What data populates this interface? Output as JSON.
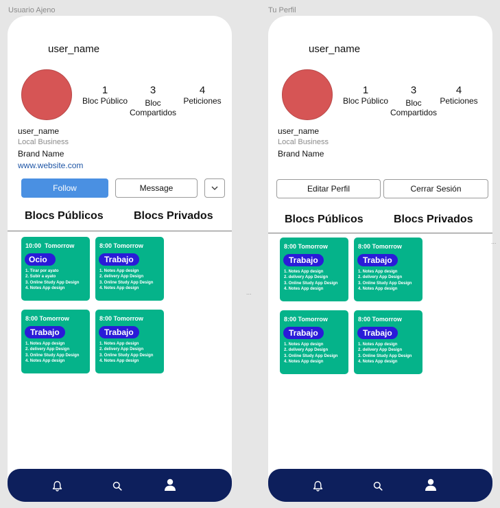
{
  "frames": {
    "left_label": "Usuario Ajeno",
    "right_label": "Tu Perfil"
  },
  "profile": {
    "username_top": "user_name",
    "display_name": "user_name",
    "category": "Local Business",
    "brand": "Brand Name",
    "website": "www.website.com",
    "avatar_color": "#d65555"
  },
  "stats": [
    {
      "value": "1",
      "label": "Bloc Público"
    },
    {
      "value": "3",
      "label_line1": "Bloc",
      "label_line2": "Compartidos"
    },
    {
      "value": "4",
      "label": "Peticiones"
    }
  ],
  "buttons": {
    "follow": "Follow",
    "message": "Message",
    "edit": "Editar Perfil",
    "logout": "Cerrar Sesión"
  },
  "tabs": {
    "public": "Blocs Públicos",
    "private": "Blocs Privados"
  },
  "cards": {
    "ocio": {
      "time": "10:00",
      "day": "Tomorrow",
      "tag": "Ocio",
      "items": [
        "1. Tirar por ayato",
        "2. Subir a ayato",
        "3. Online Study App Design",
        "4. Notes App design"
      ]
    },
    "trabajo": {
      "time": "8:00",
      "day": "Tomorrow",
      "tag": "Trabajo",
      "items": [
        "1. Notes App design",
        "2. delivery App Design",
        "3. Online Study App Design",
        "4. Notes App design"
      ]
    }
  },
  "overflow_dots": "...",
  "colors": {
    "accent": "#4a90e2",
    "card_bg": "#05b38a",
    "tag_bg": "#2a1bd8",
    "navbar": "#0d1f5c",
    "link": "#1e55a5"
  },
  "nav_icons": [
    "bell-icon",
    "search-icon",
    "user-icon"
  ]
}
